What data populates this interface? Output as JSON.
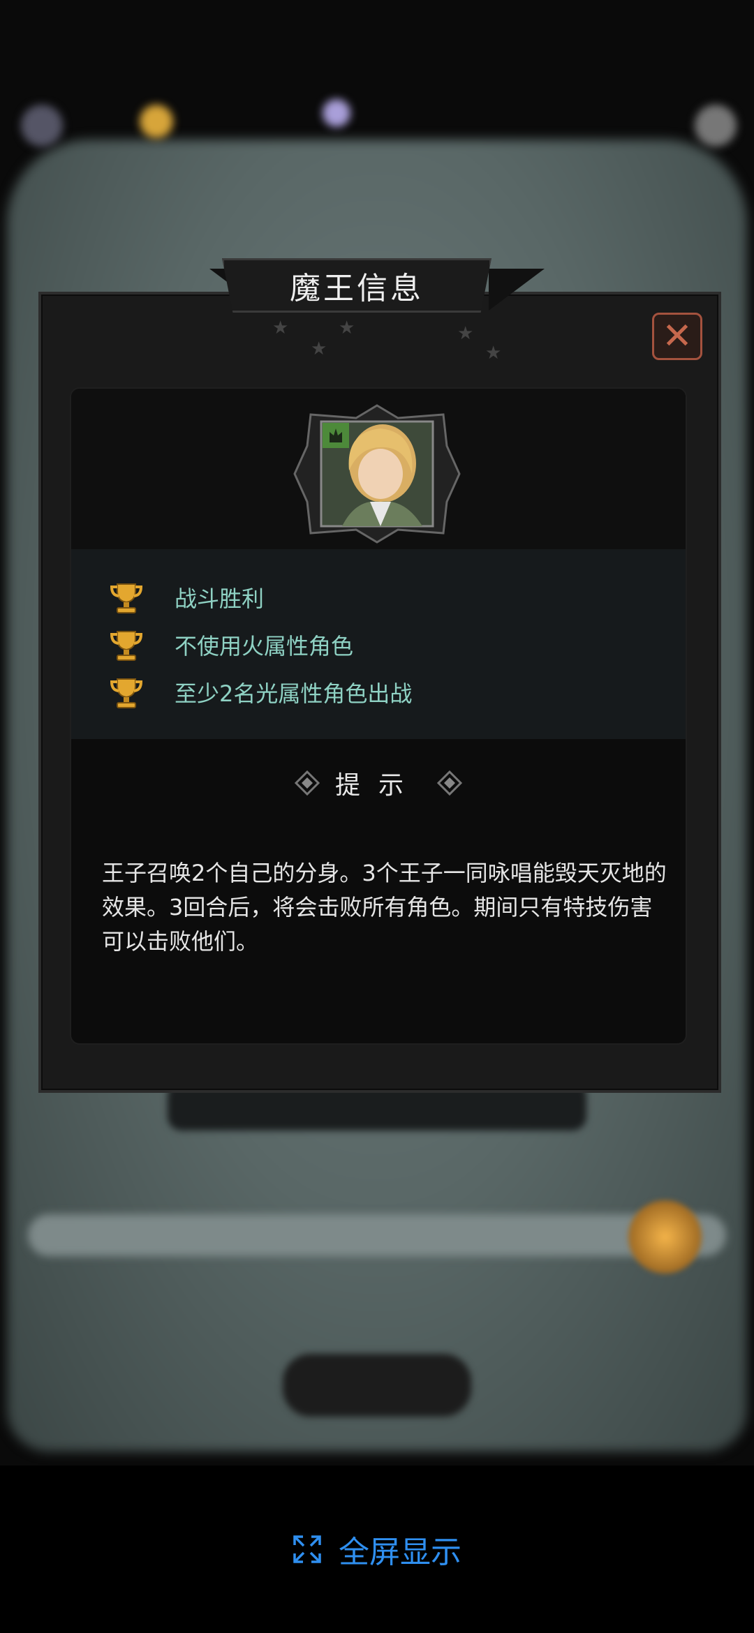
{
  "dialog": {
    "title": "魔王信息",
    "close_icon": "close-icon",
    "conditions": [
      {
        "icon": "trophy-icon",
        "text": "战斗胜利"
      },
      {
        "icon": "trophy-icon",
        "text": "不使用火属性角色"
      },
      {
        "icon": "trophy-icon",
        "text": "至少2名光属性角色出战"
      }
    ],
    "hint_title": "提示",
    "description": "王子召唤2个自己的分身。3个王子一同咏唱能毁天灭地的效果。3回合后，将会击败所有角色。期间只有特技伤害可以击败他们。"
  },
  "footer": {
    "fullscreen_label": "全屏显示",
    "fullscreen_icon": "expand-icon"
  },
  "colors": {
    "accent_text": "#8fd2c4",
    "close_border": "#a4523e",
    "fullscreen_blue": "#2f8ff0"
  }
}
